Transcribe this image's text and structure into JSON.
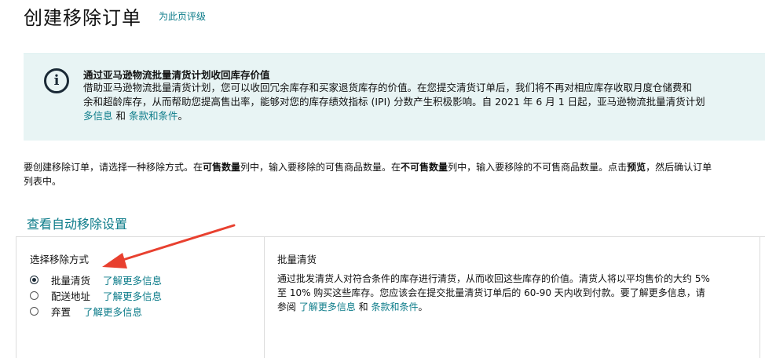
{
  "header": {
    "title": "创建移除订单",
    "rate_link": "为此页评级"
  },
  "info": {
    "icon": "info-icon",
    "title": "通过亚马逊物流批量清货计划收回库存价值",
    "line1": "借助亚马逊物流批量清货计划，您可以收回冗余库存和买家退货库存的价值。在您提交清货订单后，我们将不再对相应库存收取月度仓储费和",
    "line2": "余和超龄库存，从而帮助您提高售出率，能够对您的库存绩效指标 (IPI) 分数产生积极影响。自 2021 年 6 月 1 日起，亚马逊物流批量清货计划",
    "line3_link1": "多信息",
    "line3_and": " 和 ",
    "line3_link2": "条款和条件",
    "line3_end": "。"
  },
  "instructions": {
    "part1": "要创建移除订单，请选择一种移除方式。在",
    "bold1": "可售数量",
    "part2": "列中，输入要移除的可售商品数量。在",
    "bold2": "不可售数量",
    "part3": "列中，输入要移除的不可售商品数量。点击",
    "bold3": "预览",
    "part4": "，然后确认订单",
    "line2": "列表中。"
  },
  "auto_removal_link": "查看自动移除设置",
  "removal_method": {
    "title": "选择移除方式",
    "options": [
      {
        "label": "批量清货",
        "link": "了解更多信息",
        "selected": true
      },
      {
        "label": "配送地址",
        "link": "了解更多信息",
        "selected": false
      },
      {
        "label": "弃置",
        "link": "了解更多信息",
        "selected": false
      }
    ]
  },
  "description": {
    "title": "批量清货",
    "line1": "通过批发清货人对符合条件的库存进行清货，从而收回这些库存的价值。清货人将以平均售价的大约 5%",
    "line2": "至 10% 购买这些库存。您应该会在提交批量清货订单后的 60-90 天内收到付款。要了解更多信息，请",
    "line3_pre": "参阅 ",
    "line3_link1": "了解更多信息",
    "line3_and": " 和 ",
    "line3_link2": "条款和条件",
    "line3_end": "。"
  },
  "colors": {
    "link": "#0d7c8a",
    "info_bg": "#e8f4f4",
    "arrow": "#e8402f"
  }
}
